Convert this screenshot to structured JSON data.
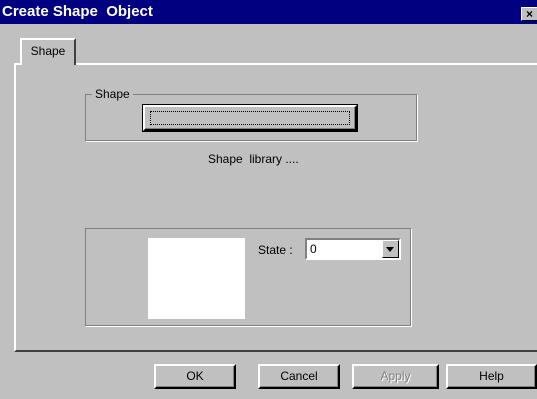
{
  "window": {
    "title": "Create Shape  Object",
    "close_glyph": "×"
  },
  "tabs": [
    {
      "label": "Shape",
      "active": true
    }
  ],
  "shape_group": {
    "label": "Shape",
    "library_button": "Shape  library ...."
  },
  "state": {
    "label": "State :",
    "value": "0"
  },
  "buttons": {
    "ok": "OK",
    "cancel": "Cancel",
    "apply": "Apply",
    "apply_disabled": true,
    "help": "Help"
  },
  "colors": {
    "titlebar": "#000080",
    "face": "#c0c0c0",
    "preview": "#ffffff"
  }
}
